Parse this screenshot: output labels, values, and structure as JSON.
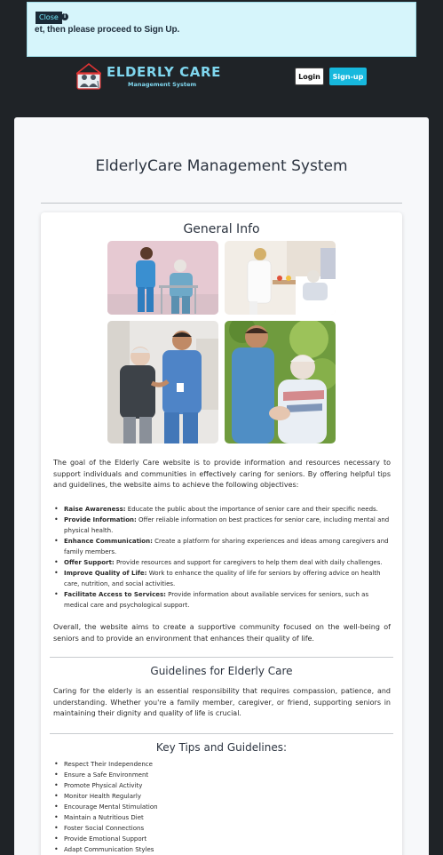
{
  "notice": {
    "close_label": "Close",
    "message": "et, then please proceed to Sign Up."
  },
  "brand": {
    "title": "ELDERLY CARE",
    "subtitle": "Management System"
  },
  "nav": {
    "login_label": "Login",
    "signup_label": "Sign-up"
  },
  "page": {
    "title": "ElderlyCare Management System"
  },
  "general_info": {
    "heading": "General Info",
    "intro": "The goal of the Elderly Care website is to provide information and resources necessary to support individuals and communities in effectively caring for seniors. By offering helpful tips and guidelines, the website aims to achieve the following objectives:",
    "objectives": [
      {
        "label": "Raise Awareness:",
        "text": " Educate the public about the importance of senior care and their specific needs."
      },
      {
        "label": "Provide Information:",
        "text": " Offer reliable information on best practices for senior care, including mental and physical health."
      },
      {
        "label": "Enhance Communication:",
        "text": " Create a platform for sharing experiences and ideas among caregivers and family members."
      },
      {
        "label": "Offer Support:",
        "text": " Provide resources and support for caregivers to help them deal with daily challenges."
      },
      {
        "label": "Improve Quality of Life:",
        "text": " Work to enhance the quality of life for seniors by offering advice on health care, nutrition, and social activities."
      },
      {
        "label": "Facilitate Access to Services:",
        "text": " Provide information about available services for seniors, such as medical care and psychological support."
      }
    ],
    "closing": "Overall, the website aims to create a supportive community focused on the well-being of seniors and to provide an environment that enhances their quality of life."
  },
  "guidelines": {
    "heading": "Guidelines for Elderly Care",
    "text": "Caring for the elderly is an essential responsibility that requires compassion, patience, and understanding. Whether you're a family member, caregiver, or friend, supporting seniors in maintaining their dignity and quality of life is crucial."
  },
  "tips": {
    "heading": "Key Tips and Guidelines:",
    "items": [
      "Respect Their Independence",
      "Ensure a Safe Environment",
      "Promote Physical Activity",
      "Monitor Health Regularly",
      "Encourage Mental Stimulation",
      "Maintain a Nutritious Diet",
      "Foster Social Connections",
      "Provide Emotional Support",
      "Adapt Communication Styles"
    ]
  },
  "icons": {
    "notice": "info-icon",
    "brand": "elderly-couple-logo-icon"
  },
  "colors": {
    "background": "#1f2327",
    "notice_bg": "#d6f5fb",
    "brand_accent": "#7fd6ee",
    "signup_button": "#17b8dd",
    "text_heading": "#2c3440"
  }
}
